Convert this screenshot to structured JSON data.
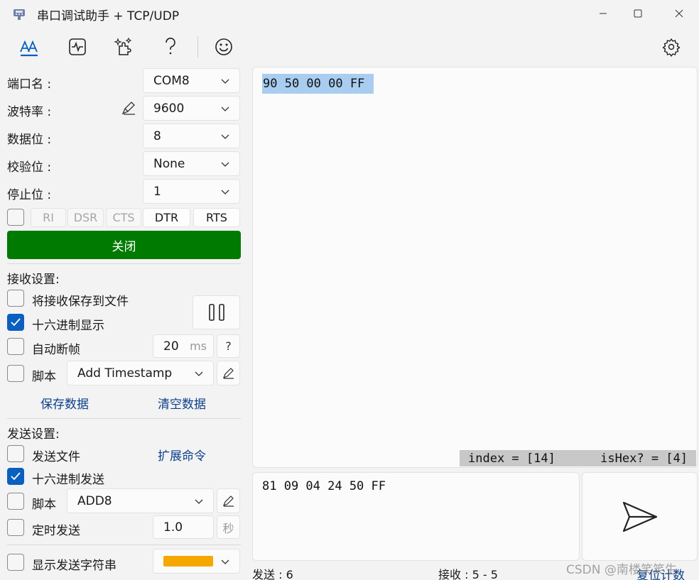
{
  "window": {
    "title": "串口调试助手 + TCP/UDP"
  },
  "toolbar": {
    "icons": [
      "font-icon",
      "waveform-icon",
      "plugin-icon",
      "help-icon",
      "smiley-icon",
      "settings-icon"
    ]
  },
  "serial": {
    "port_label": "端口名 :",
    "port_value": "COM8",
    "baud_label": "波特率 :",
    "baud_value": "9600",
    "databits_label": "数据位 :",
    "databits_value": "8",
    "parity_label": "校验位 :",
    "parity_value": "None",
    "stopbits_label": "停止位 :",
    "stopbits_value": "1",
    "signals": [
      "RI",
      "DSR",
      "CTS",
      "DTR",
      "RTS"
    ],
    "close_button": "关闭",
    "close_color": "#007a00"
  },
  "receive": {
    "header": "接收设置:",
    "save_to_file": "将接收保存到文件",
    "hex_display": "十六进制显示",
    "auto_frame": "自动断帧",
    "frame_value": "20",
    "frame_unit": "ms",
    "help": "?",
    "script_label": "脚本",
    "script_value": "Add Timestamp",
    "save_data": "保存数据",
    "clear_data": "清空数据"
  },
  "send": {
    "header": "发送设置:",
    "send_file": "发送文件",
    "extend_cmd": "扩展命令",
    "hex_send": "十六进制发送",
    "script_label": "脚本",
    "script_value": "ADD8",
    "timed_send": "定时发送",
    "timed_value": "1.0",
    "timed_unit": "秒",
    "show_string": "显示发送字符串",
    "string_color": "#f5a800"
  },
  "main": {
    "received_text": "90 50 00 00 FF",
    "status_index": "index = [14]",
    "status_ishex": "isHex? = [4]",
    "send_text": "81 09 04 24 50 FF",
    "sent_count": "发送 : 6",
    "recv_count": "接收 : 5 - 5",
    "reset_count": "复位计数",
    "watermark": "CSDN @南楼笑笑生"
  },
  "colors": {
    "accent": "#0a5fbf",
    "selection": "#a8cdf0"
  }
}
